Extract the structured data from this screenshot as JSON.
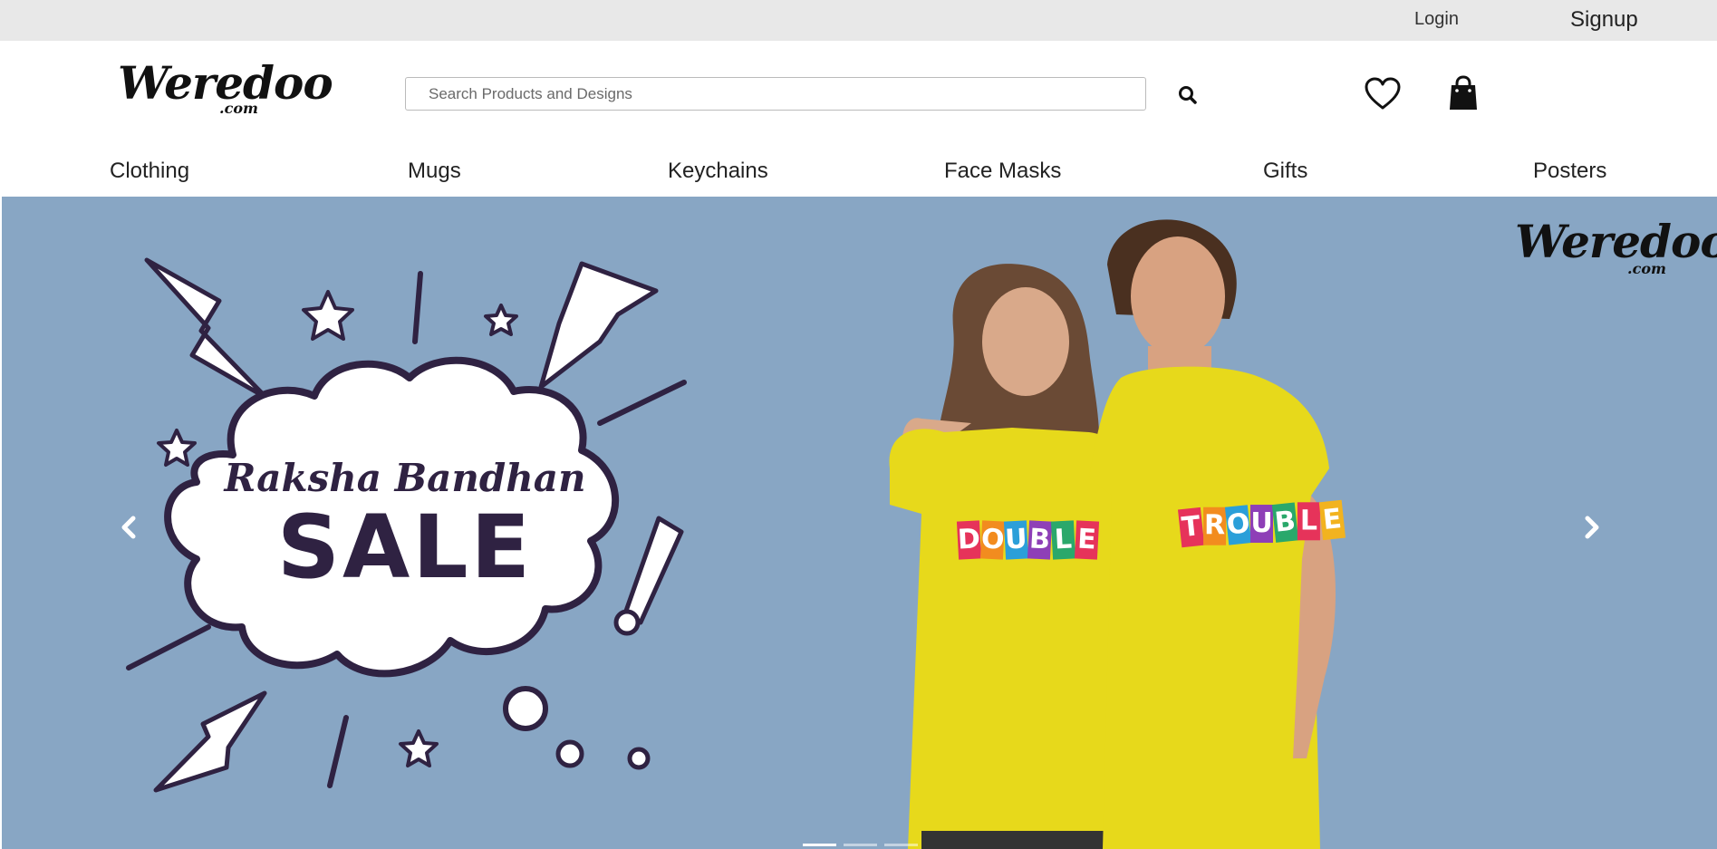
{
  "topbar": {
    "login": "Login",
    "signup": "Signup"
  },
  "brand": {
    "name": "Weredoo",
    "suffix": ".com"
  },
  "search": {
    "placeholder": "Search Products and Designs",
    "value": ""
  },
  "nav": {
    "items": [
      {
        "label": "Clothing"
      },
      {
        "label": "Mugs"
      },
      {
        "label": "Keychains"
      },
      {
        "label": "Face Masks"
      },
      {
        "label": "Gifts"
      },
      {
        "label": "Posters"
      }
    ]
  },
  "banner": {
    "title_script": "Raksha Bandhan",
    "title_bold": "SALE",
    "shirt_left": [
      "D",
      "O",
      "U",
      "B",
      "L",
      "E"
    ],
    "shirt_right": [
      "T",
      "R",
      "O",
      "U",
      "B",
      "L",
      "E"
    ],
    "slides_total": 3,
    "active_slide": 1
  },
  "colors": {
    "accent": "#2f2242",
    "banner_bg": "#88a6c4",
    "shirt": "#e7d91b",
    "tile_colors": [
      "#e6335a",
      "#f28c1f",
      "#2b9fd9",
      "#8e3fb7",
      "#2aa86b",
      "#e6335a",
      "#f2b31f"
    ]
  },
  "icons": {
    "search": "search-icon",
    "wishlist": "heart-icon",
    "cart": "shopping-bag-icon",
    "prev": "chevron-left-icon",
    "next": "chevron-right-icon"
  }
}
